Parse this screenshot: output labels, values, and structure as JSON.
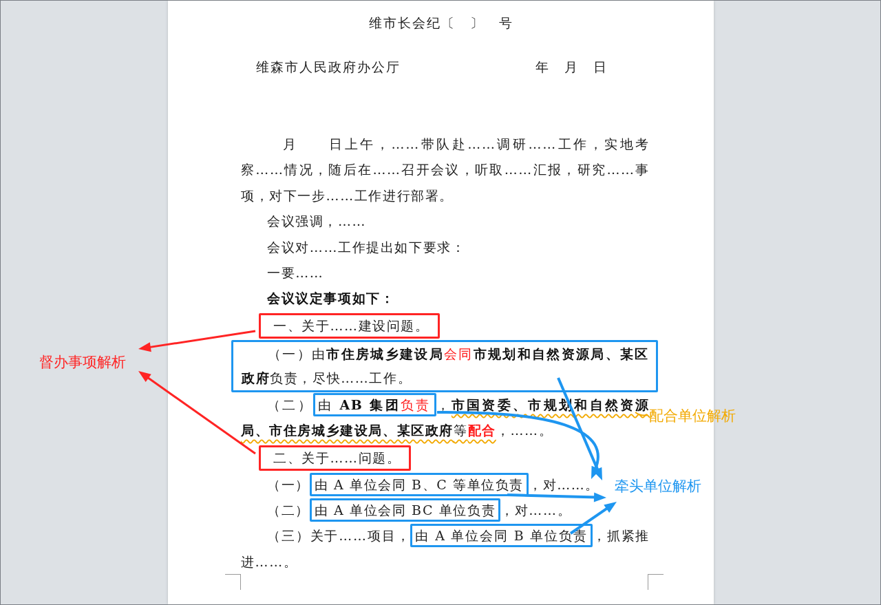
{
  "header": {
    "doc_number": "维市长会纪〔　〕　号",
    "issuer": "维森市人民政府办公厅",
    "date": "年　月　日"
  },
  "paragraphs": [
    {
      "kind": "plain",
      "runs": [
        {
          "kind": "plain",
          "parts": [
            {
              "text": "月　　日上午，……带队赴……调研……工作，实地考察……情况，随后在……召开会议，听取……汇报，研究……事项，对下一步……工作进行部署。",
              "bold": false
            }
          ]
        }
      ]
    },
    {
      "kind": "plain",
      "runs": [
        {
          "kind": "plain",
          "parts": [
            {
              "text": "会议强调，……",
              "bold": false
            }
          ]
        }
      ]
    },
    {
      "kind": "plain",
      "runs": [
        {
          "kind": "plain",
          "parts": [
            {
              "text": "会议对……工作提出如下要求：",
              "bold": false
            }
          ]
        }
      ]
    },
    {
      "kind": "plain",
      "runs": [
        {
          "kind": "plain",
          "parts": [
            {
              "text": "一要……",
              "bold": false
            }
          ]
        }
      ]
    },
    {
      "kind": "plain",
      "runs": [
        {
          "kind": "plain",
          "parts": [
            {
              "text": "会议议定事项如下：",
              "bold": true
            }
          ]
        }
      ]
    },
    {
      "kind": "supervise",
      "runs": [
        {
          "kind": "plain",
          "parts": [
            {
              "text": "一、关于……建设问题。",
              "bold": false
            }
          ]
        }
      ]
    },
    {
      "kind": "lead",
      "runs": [
        {
          "kind": "plain",
          "parts": [
            {
              "text": "（一）由",
              "bold": false
            },
            {
              "text": "市住房城乡建设局",
              "bold": true
            },
            {
              "text": "会同",
              "bold": false,
              "color": "#ff1a1a"
            },
            {
              "text": "市规划和自然资源局、某区政府",
              "bold": true
            },
            {
              "text": "负责，尽快……工作。",
              "bold": false
            }
          ]
        }
      ]
    },
    {
      "kind": "plain",
      "runs": [
        {
          "kind": "plain",
          "parts": [
            {
              "text": "（二）",
              "bold": false
            }
          ]
        },
        {
          "kind": "lead",
          "parts": [
            {
              "text": "由 ",
              "bold": false
            },
            {
              "text": "AB 集团",
              "bold": true
            },
            {
              "text": "负责",
              "bold": false,
              "color": "#ff1a1a"
            }
          ]
        },
        {
          "kind": "plain",
          "parts": [
            {
              "text": "，",
              "bold": false
            }
          ]
        },
        {
          "kind": "cooperate",
          "parts": [
            {
              "text": "市国资委、市规划和自然资源局、市住房城乡建设局、某区政府",
              "bold": true
            },
            {
              "text": "等",
              "bold": false
            },
            {
              "text": "配合",
              "bold": true,
              "color": "#ff1a1a"
            }
          ]
        },
        {
          "kind": "plain",
          "parts": [
            {
              "text": "，……。",
              "bold": false
            }
          ]
        }
      ]
    },
    {
      "kind": "supervise",
      "runs": [
        {
          "kind": "plain",
          "parts": [
            {
              "text": "二、关于……问题。",
              "bold": false
            }
          ]
        }
      ]
    },
    {
      "kind": "plain",
      "runs": [
        {
          "kind": "plain",
          "parts": [
            {
              "text": "（一）",
              "bold": false
            }
          ]
        },
        {
          "kind": "lead",
          "parts": [
            {
              "text": "由 A 单位会同 B、C 等单位负责",
              "bold": false
            }
          ]
        },
        {
          "kind": "plain",
          "parts": [
            {
              "text": "，对……。",
              "bold": false
            }
          ]
        }
      ]
    },
    {
      "kind": "plain",
      "runs": [
        {
          "kind": "plain",
          "parts": [
            {
              "text": "（二）",
              "bold": false
            }
          ]
        },
        {
          "kind": "lead",
          "parts": [
            {
              "text": "由 A 单位会同 BC 单位负责",
              "bold": false
            }
          ]
        },
        {
          "kind": "plain",
          "parts": [
            {
              "text": "，对……。",
              "bold": false
            }
          ]
        }
      ]
    },
    {
      "kind": "plain",
      "runs": [
        {
          "kind": "plain",
          "parts": [
            {
              "text": "（三）关于……项目，",
              "bold": false
            }
          ]
        },
        {
          "kind": "lead",
          "parts": [
            {
              "text": "由 A 单位会同 B 单位负责",
              "bold": false
            }
          ]
        },
        {
          "kind": "plain",
          "parts": [
            {
              "text": "，抓紧推进……。",
              "bold": false
            }
          ]
        }
      ]
    }
  ],
  "annotations": {
    "supervise_label": "督办事项解析",
    "cooperate_label": "配合单位解析",
    "lead_label": "牵头单位解析"
  }
}
